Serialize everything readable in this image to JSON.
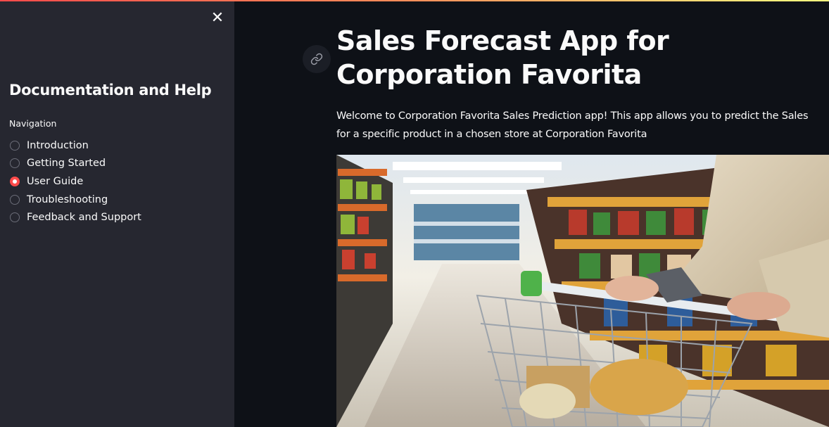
{
  "sidebar": {
    "close_label": "✕",
    "title": "Documentation and Help",
    "nav_label": "Navigation",
    "items": [
      {
        "label": "Introduction",
        "selected": false
      },
      {
        "label": "Getting Started",
        "selected": false
      },
      {
        "label": "User Guide",
        "selected": true
      },
      {
        "label": "Troubleshooting",
        "selected": false
      },
      {
        "label": "Feedback and Support",
        "selected": false
      }
    ]
  },
  "main": {
    "title": "Sales Forecast App for Corporation Favorita",
    "description": "Welcome to Corporation Favorita Sales Prediction app! This app allows you to predict the Sales for a specific product in a chosen store at Corporation Favorita",
    "anchor_icon": "link-icon",
    "image_subject": "supermarket-aisle-with-shopping-cart"
  },
  "colors": {
    "accent": "#ff4b4b",
    "sidebar_bg": "#262730",
    "main_bg": "#0e1117",
    "text": "#fafafa"
  }
}
